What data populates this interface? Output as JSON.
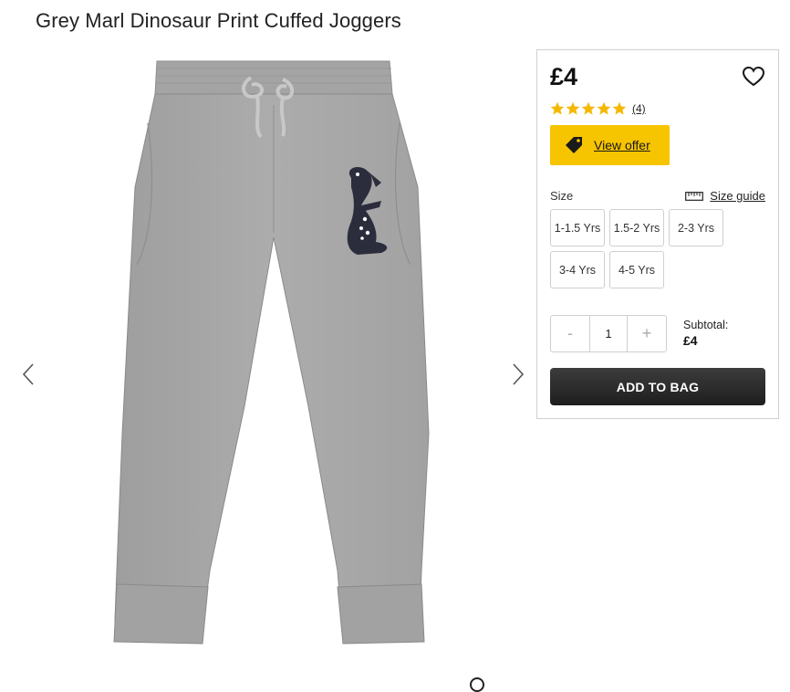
{
  "product": {
    "title": "Grey Marl Dinosaur Print Cuffed Joggers",
    "image_icon": "grey-joggers-with-dinosaur-print"
  },
  "gallery": {
    "prev_icon": "chevron-left-icon",
    "next_icon": "chevron-right-icon"
  },
  "panel": {
    "price": "£4",
    "wishlist_icon": "heart-outline-icon",
    "rating": {
      "stars": 5,
      "max": 5,
      "count": "(4)"
    },
    "offer": {
      "label": "View offer",
      "icon": "price-tag-icon",
      "color": "#f7c400"
    },
    "size": {
      "label": "Size",
      "guide_label": "Size guide",
      "guide_icon": "ruler-icon",
      "options": [
        "1-1.5 Yrs",
        "1.5-2 Yrs",
        "2-3 Yrs",
        "3-4 Yrs",
        "4-5 Yrs"
      ]
    },
    "quantity": {
      "minus": "-",
      "value": "1",
      "plus": "+"
    },
    "subtotal": {
      "label": "Subtotal:",
      "value": "£4"
    },
    "add_to_bag": "ADD TO BAG"
  },
  "colors": {
    "star": "#f5b800",
    "button_dark": "#2a2a2a"
  }
}
